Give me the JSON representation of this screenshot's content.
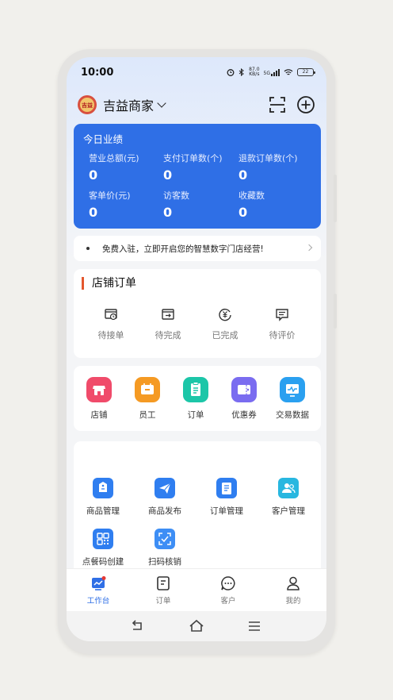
{
  "status_bar": {
    "time": "10:00",
    "speed": "87.0",
    "speed_unit": "KB/s",
    "network": "5G",
    "battery": "22"
  },
  "header": {
    "store_name": "吉益商家",
    "logo_text": "吉益",
    "scan_icon": "scan-icon",
    "add_icon": "plus-circle-icon"
  },
  "performance": {
    "title": "今日业绩",
    "metrics": [
      {
        "label": "营业总额(元)",
        "value": "0"
      },
      {
        "label": "支付订单数(个)",
        "value": "0"
      },
      {
        "label": "退款订单数(个)",
        "value": "0"
      },
      {
        "label": "客单价(元)",
        "value": "0"
      },
      {
        "label": "访客数",
        "value": "0"
      },
      {
        "label": "收藏数",
        "value": "0"
      }
    ]
  },
  "notice": {
    "text": "免费入驻，立即开启您的智慧数字门店经营!"
  },
  "store_orders": {
    "title": "店铺订单",
    "items": [
      {
        "label": "待接单",
        "icon": "pending-order-icon"
      },
      {
        "label": "待完成",
        "icon": "in-progress-icon"
      },
      {
        "label": "已完成",
        "icon": "completed-yen-icon"
      },
      {
        "label": "待评价",
        "icon": "review-icon"
      }
    ]
  },
  "tools": [
    {
      "label": "店铺",
      "icon": "store-icon",
      "color": "#f04b6a"
    },
    {
      "label": "员工",
      "icon": "staff-icon",
      "color": "#f59a23"
    },
    {
      "label": "订单",
      "icon": "order-icon",
      "color": "#1cc6a8"
    },
    {
      "label": "优惠券",
      "icon": "coupon-icon",
      "color": "#7a6cf0"
    },
    {
      "label": "交易数据",
      "icon": "trade-data-icon",
      "color": "#2aa0f0"
    }
  ],
  "management": [
    {
      "label": "商品管理",
      "icon": "product-manage-icon",
      "color": "#2f7ef0"
    },
    {
      "label": "商品发布",
      "icon": "product-publish-icon",
      "color": "#2f7ef0"
    },
    {
      "label": "订单管理",
      "icon": "order-manage-icon",
      "color": "#2f7ef0"
    },
    {
      "label": "客户管理",
      "icon": "customer-manage-icon",
      "color": "#28b7e0"
    },
    {
      "label": "点餐码创建",
      "icon": "qr-create-icon",
      "color": "#2f7ef0"
    },
    {
      "label": "扫码核销",
      "icon": "scan-verify-icon",
      "color": "#3d8ef5"
    }
  ],
  "tabbar": [
    {
      "label": "工作台",
      "icon": "workbench-icon",
      "active": true
    },
    {
      "label": "订单",
      "icon": "order-tab-icon",
      "active": false
    },
    {
      "label": "客户",
      "icon": "customer-chat-icon",
      "active": false
    },
    {
      "label": "我的",
      "icon": "profile-icon",
      "active": false
    }
  ],
  "colors": {
    "primary": "#2f6fe6",
    "accent_bar": "#e4572e",
    "badge": "#e53935"
  }
}
